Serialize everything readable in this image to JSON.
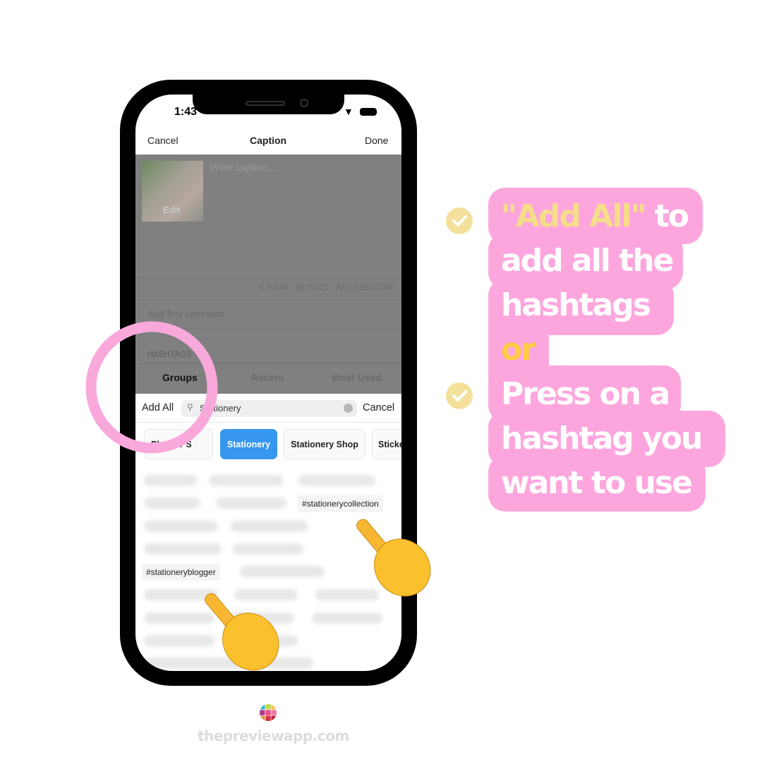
{
  "status": {
    "time": "1:43"
  },
  "nav": {
    "cancel": "Cancel",
    "title": "Caption",
    "done": "Done"
  },
  "caption": {
    "placeholder": "Write caption...",
    "edit": "Edit",
    "counters": "# 30/30   @ 20/20   Abc 2200/2200",
    "first_comment": "Add first comment"
  },
  "hashtags": {
    "section": "HASHTAGS",
    "tabs": [
      "Groups",
      "Recent",
      "Most Used"
    ],
    "add_all": "Add All",
    "search_value": "Stationery",
    "cancel": "Cancel",
    "chips": [
      "Planner S",
      "Stationery",
      "Stationery Shop",
      "Sticke"
    ],
    "visible_tags": [
      "#stationerycollection",
      "#stationeryblogger"
    ]
  },
  "callout": {
    "lines": [
      "\"Add All\"",
      "to",
      "add all the",
      "hashtags",
      "or",
      "Press on a",
      "hashtag you",
      "want to use"
    ]
  },
  "colors": {
    "pink": "#fda6de",
    "yellow": "#f6dd8a",
    "or_yellow": "#ffcc44",
    "selected_chip": "#3797ee",
    "circle": "#f9a8dc"
  },
  "footer": {
    "site": "thepreviewapp.com"
  }
}
